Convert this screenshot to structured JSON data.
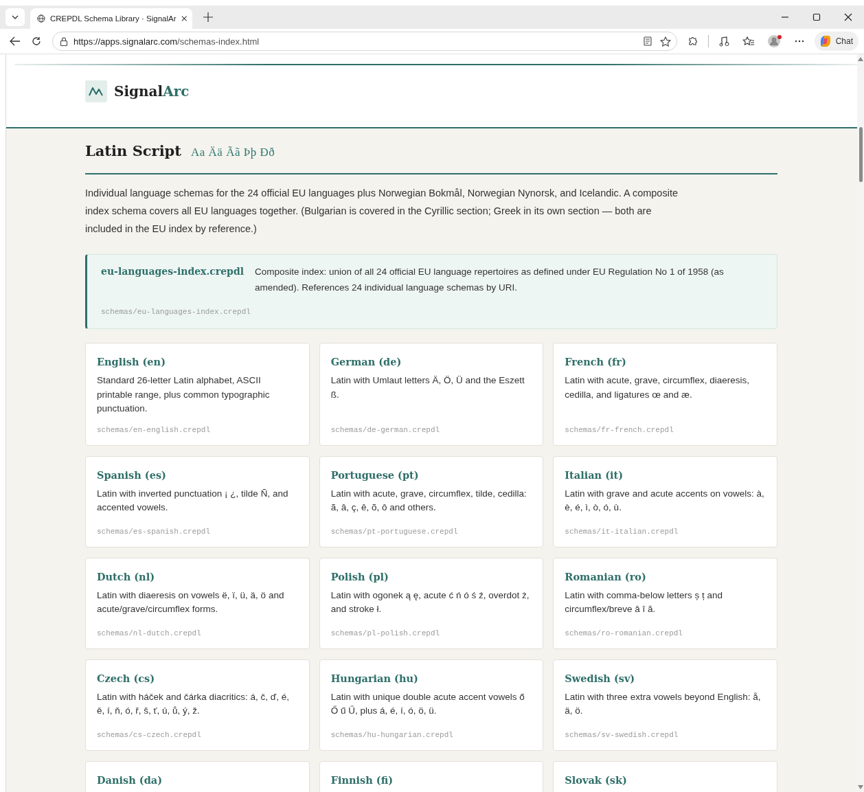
{
  "browser": {
    "tab_title": "CREPDL Schema Library · SignalAr",
    "url_host": "https://apps.signalarc.com",
    "url_path": "/schemas-index.html",
    "chat_label": "Chat"
  },
  "site": {
    "brand_primary": "Signal",
    "brand_accent": "Arc"
  },
  "section": {
    "title": "Latin Script",
    "sample": "Aa Ää Ãã Þþ Ðð",
    "intro": "Individual language schemas for the 24 official EU languages plus Norwegian Bokmål, Norwegian Nynorsk, and Icelandic. A composite index schema covers all EU languages together. (Bulgarian is covered in the Cyrillic section; Greek in its own section — both are included in the EU index by reference.)"
  },
  "index_schema": {
    "name": "eu-languages-index.crepdl",
    "description": "Composite index: union of all 24 official EU language repertoires as defined under EU Regulation No 1 of 1958 (as amended). References 24 individual language schemas by URI.",
    "path": "schemas/eu-languages-index.crepdl"
  },
  "schemas": [
    {
      "title": "English (en)",
      "description": "Standard 26-letter Latin alphabet, ASCII printable range, plus common typographic punctuation.",
      "path": "schemas/en-english.crepdl"
    },
    {
      "title": "German (de)",
      "description": "Latin with Umlaut letters Ä, Ö, Ü and the Eszett ß.",
      "path": "schemas/de-german.crepdl"
    },
    {
      "title": "French (fr)",
      "description": "Latin with acute, grave, circumflex, diaeresis, cedilla, and ligatures œ and æ.",
      "path": "schemas/fr-french.crepdl"
    },
    {
      "title": "Spanish (es)",
      "description": "Latin with inverted punctuation ¡ ¿, tilde Ñ, and accented vowels.",
      "path": "schemas/es-spanish.crepdl"
    },
    {
      "title": "Portuguese (pt)",
      "description": "Latin with acute, grave, circumflex, tilde, cedilla: ã, â, ç, ê, õ, ô and others.",
      "path": "schemas/pt-portuguese.crepdl"
    },
    {
      "title": "Italian (it)",
      "description": "Latin with grave and acute accents on vowels: à, è, é, ì, ò, ó, ù.",
      "path": "schemas/it-italian.crepdl"
    },
    {
      "title": "Dutch (nl)",
      "description": "Latin with diaeresis on vowels ë, ï, ü, ä, ö and acute/grave/circumflex forms.",
      "path": "schemas/nl-dutch.crepdl"
    },
    {
      "title": "Polish (pl)",
      "description": "Latin with ogonek ą ę, acute ć ń ó ś ź, overdot ż, and stroke ł.",
      "path": "schemas/pl-polish.crepdl"
    },
    {
      "title": "Romanian (ro)",
      "description": "Latin with comma-below letters ș ț and circumflex/breve â î ă.",
      "path": "schemas/ro-romanian.crepdl"
    },
    {
      "title": "Czech (cs)",
      "description": "Latin with háček and čárka diacritics: á, č, ď, é, ě, í, ň, ó, ř, š, ť, ú, ů, ý, ž.",
      "path": "schemas/cs-czech.crepdl"
    },
    {
      "title": "Hungarian (hu)",
      "description": "Latin with unique double acute accent vowels ő Ő ű Ű, plus á, é, í, ó, ö, ü.",
      "path": "schemas/hu-hungarian.crepdl"
    },
    {
      "title": "Swedish (sv)",
      "description": "Latin with three extra vowels beyond English: å, ä, ö.",
      "path": "schemas/sv-swedish.crepdl"
    },
    {
      "title": "Danish (da)"
    },
    {
      "title": "Finnish (fi)"
    },
    {
      "title": "Slovak (sk)"
    }
  ]
}
